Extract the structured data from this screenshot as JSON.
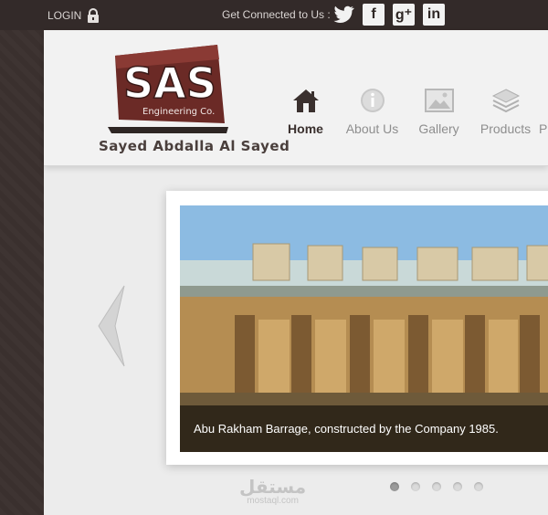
{
  "topbar": {
    "login_label": "LOGIN",
    "connect_label": "Get Connected to Us :",
    "social": [
      {
        "name": "twitter-icon",
        "glyph": ""
      },
      {
        "name": "facebook-icon",
        "glyph": "f"
      },
      {
        "name": "google-plus-icon",
        "glyph": "g⁺"
      },
      {
        "name": "linkedin-icon",
        "glyph": "in"
      }
    ]
  },
  "header": {
    "logo_text": "SAS",
    "logo_subtext": "Engineering Co.",
    "tagline": "Sayed Abdalla Al Sayed"
  },
  "nav": {
    "items": [
      {
        "label": "Home",
        "icon": "house-icon",
        "active": true
      },
      {
        "label": "About Us",
        "icon": "info-icon"
      },
      {
        "label": "Gallery",
        "icon": "image-icon"
      },
      {
        "label": "Products",
        "icon": "layers-icon"
      },
      {
        "label": "P",
        "icon": "more-icon"
      }
    ]
  },
  "slider": {
    "caption": "Abu Rakham Barrage, constructed by the Company 1985.",
    "dot_count": 5,
    "active_index": 0
  },
  "watermark": {
    "arabic": "مستقل",
    "latin": "mostaql.com"
  },
  "colors": {
    "dark_brown": "#3a302e",
    "logo_maroon": "#6b2a26",
    "panel_bg": "#ececec"
  }
}
